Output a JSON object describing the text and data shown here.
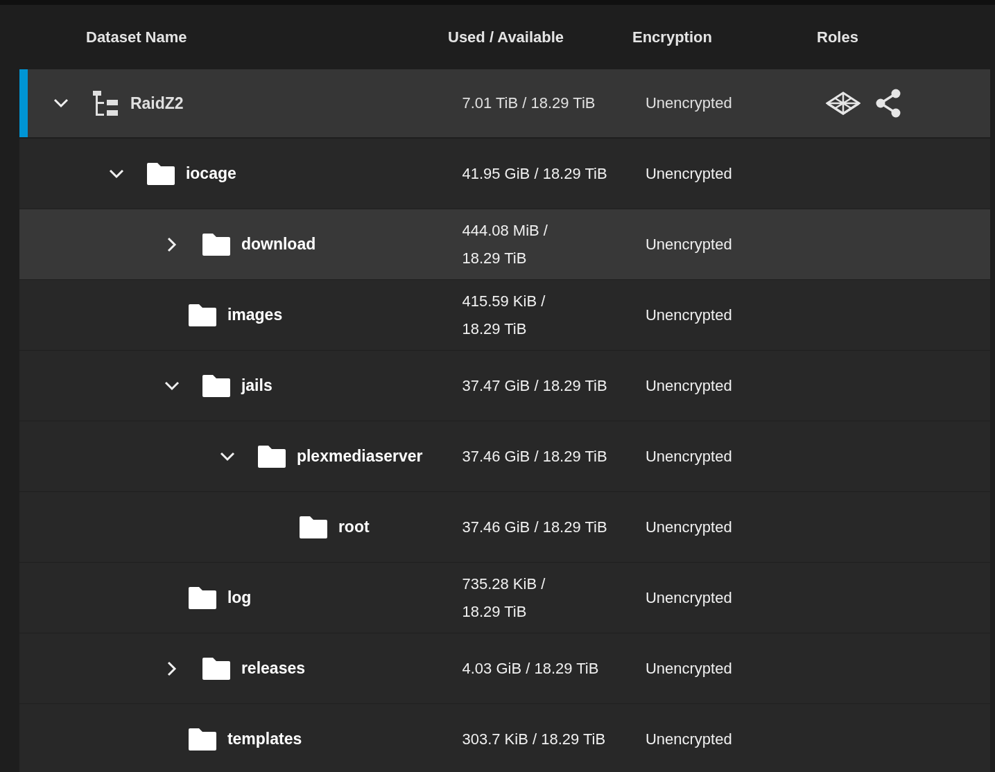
{
  "table": {
    "columns": [
      "Dataset Name",
      "Used / Available",
      "Encryption",
      "Roles"
    ],
    "rows": [
      {
        "name": "RaidZ2",
        "kind": "pool",
        "used": "7.01 TiB / 18.29 TiB",
        "encryption": "Unencrypted",
        "selected": true,
        "highlighted": false,
        "expanded": true,
        "roles": [
          {
            "kind": "system"
          },
          {
            "kind": "share"
          }
        ],
        "children": [
          {
            "name": "iocage",
            "kind": "dataset",
            "used": "41.95 GiB / 18.29 TiB",
            "encryption": "Unencrypted",
            "selected": false,
            "highlighted": false,
            "expanded": true,
            "children": [
              {
                "name": "download",
                "kind": "dataset",
                "used": "444.08 MiB / 18.29 TiB",
                "encryption": "Unencrypted",
                "selected": false,
                "highlighted": true,
                "expanded": false
              },
              {
                "name": "images",
                "kind": "dataset",
                "used": "415.59 KiB / 18.29 TiB",
                "encryption": "Unencrypted",
                "selected": false,
                "highlighted": false
              },
              {
                "name": "jails",
                "kind": "dataset",
                "used": "37.47 GiB / 18.29 TiB",
                "encryption": "Unencrypted",
                "selected": false,
                "highlighted": false,
                "expanded": true,
                "children": [
                  {
                    "name": "plexmediaserver",
                    "kind": "dataset",
                    "used": "37.46 GiB / 18.29 TiB",
                    "encryption": "Unencrypted",
                    "selected": false,
                    "highlighted": false,
                    "expanded": true,
                    "children": [
                      {
                        "name": "root",
                        "kind": "dataset",
                        "used": "37.46 GiB / 18.29 TiB",
                        "encryption": "Unencrypted",
                        "selected": false,
                        "highlighted": false
                      }
                    ]
                  }
                ]
              },
              {
                "name": "log",
                "kind": "dataset",
                "used": "735.28 KiB / 18.29 TiB",
                "encryption": "Unencrypted",
                "selected": false,
                "highlighted": false
              },
              {
                "name": "releases",
                "kind": "dataset",
                "used": "4.03 GiB / 18.29 TiB",
                "encryption": "Unencrypted",
                "selected": false,
                "highlighted": false,
                "expanded": false
              },
              {
                "name": "templates",
                "kind": "dataset",
                "used": "303.7 KiB / 18.29 TiB",
                "encryption": "Unencrypted",
                "selected": false,
                "highlighted": false
              }
            ]
          }
        ]
      }
    ]
  }
}
